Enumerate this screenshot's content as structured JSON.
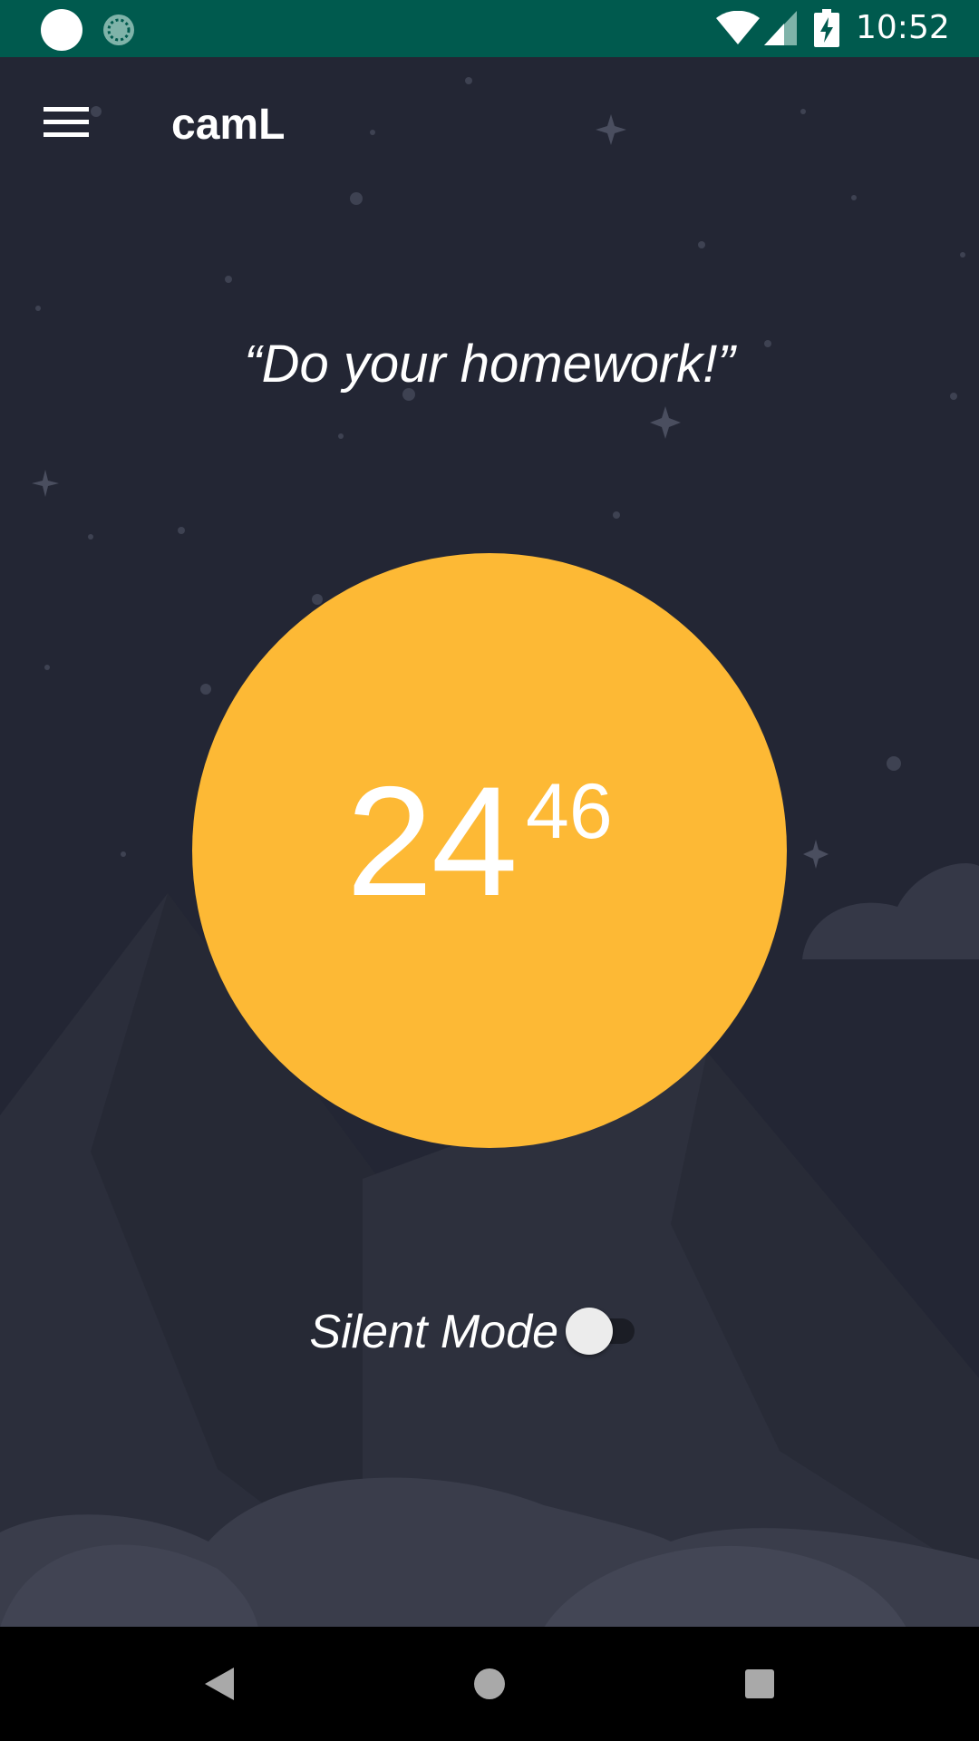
{
  "status_bar": {
    "time": "10:52",
    "icons": [
      "notification-dot-icon",
      "sync-icon",
      "wifi-icon",
      "cell-signal-icon",
      "battery-charging-icon"
    ],
    "background_color": "#005a4e"
  },
  "app_bar": {
    "title": "camL",
    "menu_icon": "hamburger-menu-icon"
  },
  "quote": {
    "text": "“Do your homework!”"
  },
  "timer": {
    "main": "24",
    "superscript": "46",
    "circle_color": "#fdb935"
  },
  "silent_mode": {
    "label": "Silent Mode",
    "enabled": false
  },
  "nav_bar": {
    "icons": [
      "back-icon",
      "home-icon",
      "recents-icon"
    ]
  },
  "theme": {
    "background": "#232634",
    "accent": "#fdb935",
    "text": "#ffffff"
  }
}
